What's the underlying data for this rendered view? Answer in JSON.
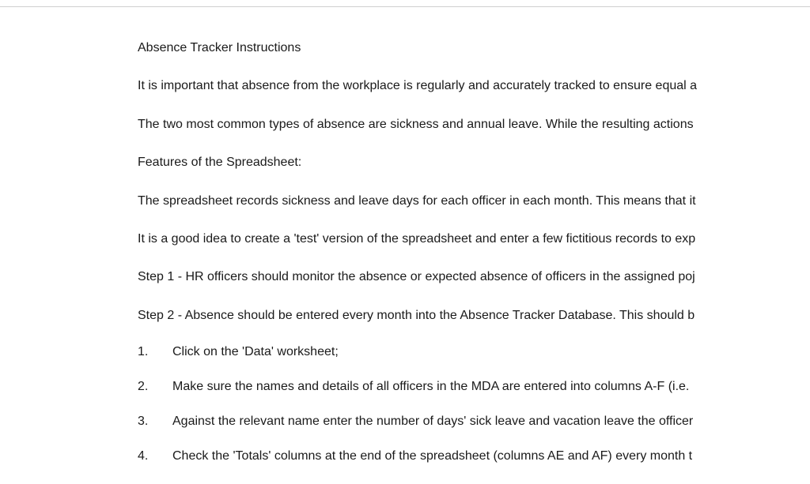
{
  "document": {
    "title": "Absence Tracker Instructions",
    "paragraphs": [
      "It is important that absence from the workplace is regularly and accurately tracked to ensure equal a",
      "The two most common types of absence are sickness and annual leave. While the resulting actions",
      "Features of the Spreadsheet:",
      "The spreadsheet records sickness and leave days for each officer in each month. This means that it",
      "It is a good idea to create a 'test' version of the spreadsheet and enter a few fictitious records to exp",
      "Step 1 - HR officers should monitor the absence or expected absence of officers in the assigned poj",
      "Step 2 - Absence should be entered every month into the Absence Tracker Database. This should b"
    ],
    "numbered_items": [
      {
        "num": "1.",
        "text": "Click on the 'Data' worksheet;"
      },
      {
        "num": "2.",
        "text": "Make sure the names and details of all officers in the MDA are entered into columns A-F (i.e."
      },
      {
        "num": "3.",
        "text": "Against the relevant name enter the number of days' sick leave and vacation leave the officer"
      },
      {
        "num": "4.",
        "text": "Check the 'Totals' columns at the end of the spreadsheet (columns AE and AF) every month t"
      }
    ]
  }
}
